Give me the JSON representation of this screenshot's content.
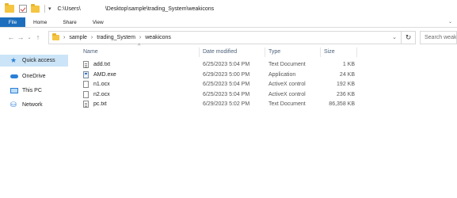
{
  "title": {
    "path_left": "C:\\Users\\",
    "path_right": "\\Desktop\\sample\\trading_System\\weakicons"
  },
  "ribbon": {
    "tabs": [
      "File",
      "Home",
      "Share",
      "View"
    ]
  },
  "address": {
    "crumbs": [
      "sample",
      "trading_System",
      "weakicons"
    ]
  },
  "search": {
    "placeholder": "Search weakicons"
  },
  "navpane": {
    "items": [
      {
        "label": "Quick access",
        "icon": "star-icon",
        "selected": true
      },
      {
        "label": "OneDrive",
        "icon": "cloud-icon",
        "selected": false
      },
      {
        "label": "This PC",
        "icon": "computer-icon",
        "selected": false
      },
      {
        "label": "Network",
        "icon": "network-icon",
        "selected": false
      }
    ]
  },
  "columns": {
    "name": "Name",
    "date": "Date modified",
    "type": "Type",
    "size": "Size"
  },
  "files": [
    {
      "name": "add.txt",
      "date": "6/25/2023 5:04 PM",
      "type": "Text Document",
      "size": "1 KB",
      "icon": "text-file-icon"
    },
    {
      "name": "AMD.exe",
      "date": "6/29/2023 5:00 PM",
      "type": "Application",
      "size": "24 KB",
      "icon": "exe-file-icon"
    },
    {
      "name": "n1.ocx",
      "date": "6/25/2023 5:04 PM",
      "type": "ActiveX control",
      "size": "192 KB",
      "icon": "file-icon"
    },
    {
      "name": "n2.ocx",
      "date": "6/25/2023 5:04 PM",
      "type": "ActiveX control",
      "size": "236 KB",
      "icon": "file-icon"
    },
    {
      "name": "pc.txt",
      "date": "6/29/2023 5:02 PM",
      "type": "Text Document",
      "size": "86,358 KB",
      "icon": "text-file-icon"
    }
  ],
  "colors": {
    "file_tab": "#1d6fbd",
    "selection": "#cce4f7",
    "header_text": "#4c607a"
  }
}
